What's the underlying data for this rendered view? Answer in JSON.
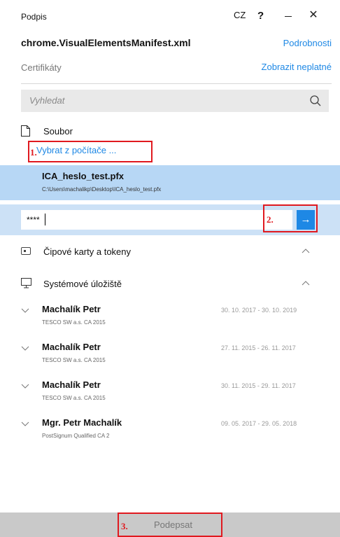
{
  "window": {
    "title": "Podpis",
    "language": "CZ",
    "help": "?",
    "minimize": "–",
    "close": "✕"
  },
  "file": {
    "name": "chrome.VisualElementsManifest.xml",
    "details_link": "Podrobnosti"
  },
  "certificates": {
    "label": "Certifikáty",
    "show_invalid_link": "Zobrazit neplatné"
  },
  "search": {
    "placeholder": "Vyhledat"
  },
  "file_section": {
    "label": "Soubor",
    "choose_link": "Vybrat z počítače ...",
    "step_number": "1."
  },
  "selected_file": {
    "name": "ICA_heslo_test.pfx",
    "path": "C:\\Users\\machalikp\\Desktop\\ICA_heslo_test.pfx"
  },
  "password": {
    "value": "****",
    "step_number": "2.",
    "submit_icon": "→"
  },
  "sections": {
    "cards": "Čipové karty a tokeny",
    "system": "Systémové úložiště"
  },
  "cert_list": [
    {
      "name": "Machalík Petr",
      "issuer": "TESCO SW a.s. CA 2015",
      "dates": "30. 10. 2017 - 30. 10. 2019"
    },
    {
      "name": "Machalík Petr",
      "issuer": "TESCO SW a.s. CA 2015",
      "dates": "27. 11. 2015 - 26. 11. 2017"
    },
    {
      "name": "Machalík Petr",
      "issuer": "TESCO SW a.s. CA 2015",
      "dates": "30. 11. 2015 - 29. 11. 2017"
    },
    {
      "name": "Mgr. Petr Machalík",
      "issuer": "PostSignum Qualified CA 2",
      "dates": "09. 05. 2017 - 29. 05. 2018"
    }
  ],
  "footer": {
    "sign_label": "Podepsat",
    "step_number": "3."
  },
  "colors": {
    "accent": "#1e88e5",
    "selection": "#b7d7f5",
    "password_bar": "#cce1f6",
    "annotation": "#e0191f",
    "footer": "#c9c9c9"
  },
  "icons": [
    "minimize-icon",
    "close-icon",
    "search-icon",
    "document-icon",
    "arrow-right-icon",
    "chip-card-icon",
    "monitor-icon",
    "chevron-up-icon",
    "chevron-down-icon"
  ]
}
